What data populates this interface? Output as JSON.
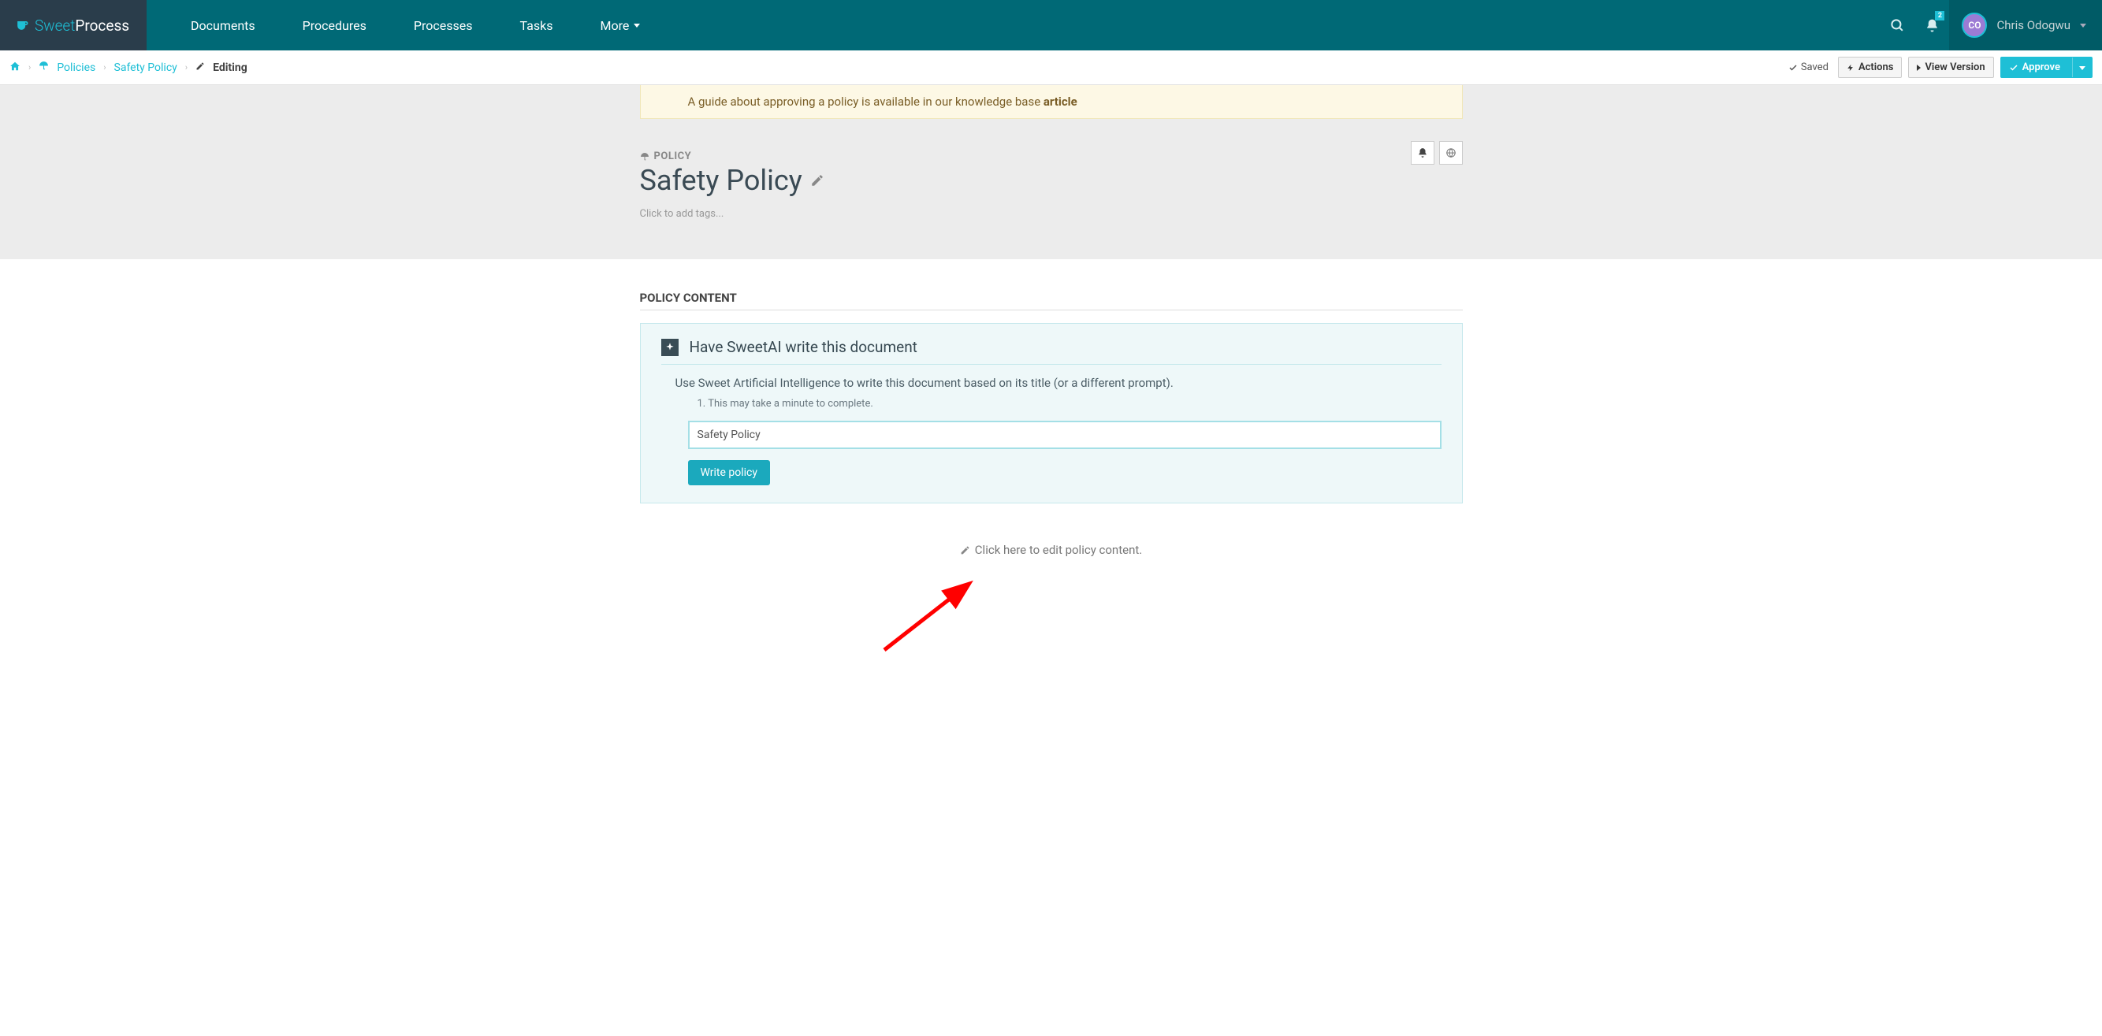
{
  "brand": {
    "sweet": "Sweet",
    "process": "Process"
  },
  "nav": {
    "documents": "Documents",
    "procedures": "Procedures",
    "processes": "Processes",
    "tasks": "Tasks",
    "more": "More"
  },
  "notification_count": "2",
  "user": {
    "initials": "CO",
    "name": "Chris Odogwu"
  },
  "breadcrumb": {
    "policies": "Policies",
    "policy_name": "Safety Policy",
    "state": "Editing"
  },
  "status": {
    "saved": "Saved"
  },
  "buttons": {
    "actions": "Actions",
    "view_version": "View Version",
    "approve": "Approve"
  },
  "banner": {
    "text_prefix": "A guide about approving a policy is available in our knowledge base ",
    "text_bold": "article"
  },
  "policy": {
    "type_label": "POLICY",
    "title": "Safety Policy",
    "tags_placeholder": "Click to add tags..."
  },
  "content": {
    "section_header": "POLICY CONTENT",
    "ai_title": "Have SweetAI write this document",
    "ai_desc": "Use Sweet Artificial Intelligence to write this document based on its title (or a different prompt).",
    "ai_note": "1. This may take a minute to complete.",
    "ai_input_value": "Safety Policy",
    "write_button": "Write policy",
    "edit_content": "Click here to edit policy content."
  }
}
